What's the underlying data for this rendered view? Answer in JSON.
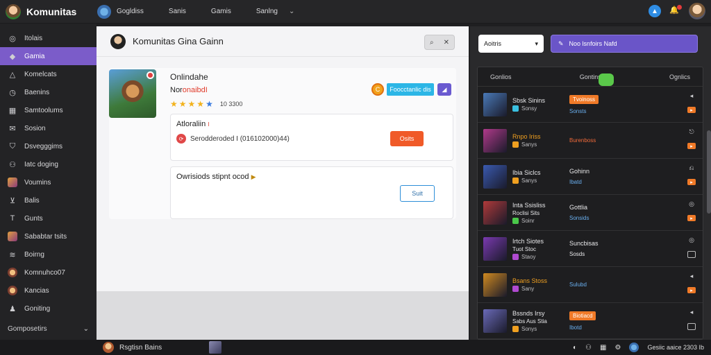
{
  "app": {
    "brand": "Komunitas"
  },
  "topnav": {
    "items": [
      "Gogldiss",
      "Sanis",
      "Gamis",
      "Sanlng"
    ]
  },
  "sidebar": {
    "items": [
      {
        "label": "Itolais",
        "icon": "compass-icon"
      },
      {
        "label": "Gamia",
        "icon": "flame-icon",
        "active": true
      },
      {
        "label": "Komelcats",
        "icon": "triangle-icon"
      },
      {
        "label": "Baenins",
        "icon": "clock-icon"
      },
      {
        "label": "Samtoolums",
        "icon": "grid-icon"
      },
      {
        "label": "Sosion",
        "icon": "mail-icon"
      },
      {
        "label": "Dsvegggims",
        "icon": "shield-icon"
      },
      {
        "label": "Iatc doging",
        "icon": "users-icon"
      },
      {
        "label": "Voumins",
        "icon": "game-avatar-icon"
      },
      {
        "label": "Balis",
        "icon": "chevron-box-icon"
      },
      {
        "label": "Gunts",
        "icon": "text-icon"
      },
      {
        "label": "Sababtar tsits",
        "icon": "card-icon"
      },
      {
        "label": "Boirng",
        "icon": "wave-icon"
      },
      {
        "label": "Komnuhco07",
        "icon": "orb-icon"
      },
      {
        "label": "Kancias",
        "icon": "avatar-icon"
      },
      {
        "label": "Goniting",
        "icon": "person-icon"
      }
    ],
    "footer": "Gomposetirs"
  },
  "main": {
    "header_title": "Komunitas Gina Gainn",
    "card": {
      "title": "Onlindahe",
      "status_prefix": "Nor",
      "status_red": "onaibd",
      "status_mark": "I",
      "rating_text": "10 3300",
      "stars": {
        "filled": 4,
        "blue": 1,
        "total": 5
      },
      "coin_symbol": "C",
      "cta_label": "Foocctanlic dis",
      "share_symbol": "◢",
      "sub1": {
        "title": "Atloraliin",
        "title_red": "I",
        "row_text": "Serodderoded I (016102000)44)",
        "button": "Osits"
      },
      "sub2": {
        "title": "Owrisiods stipnt ocod",
        "button": "Suit"
      }
    }
  },
  "right": {
    "select_label": "Aoitris",
    "action_label": "Noo lsnfoirs Nafd",
    "headers": [
      "Gonlios",
      "Gontins",
      "Ognlics"
    ],
    "rows": [
      {
        "name": "Sbsk Sinins",
        "sub": "Sonsy",
        "mid1": "Tvoinoss",
        "mid1_type": "tag",
        "mid2": "Sonsts",
        "mid2_color": "blue",
        "thumb": "#4a7ab8"
      },
      {
        "name": "Rnpo Iriss",
        "name_color": "orange",
        "sub": "Sanys",
        "mid1": "Burenboss",
        "mid1_type": "red",
        "mid2": "",
        "mid2_color": "",
        "thumb": "#b03a8a"
      },
      {
        "name": "Ibia Siclcs",
        "sub": "Sanys",
        "mid1": "Gohinn",
        "mid1_type": "white",
        "mid2": "Ibatd",
        "mid2_color": "blue",
        "thumb": "#3a5ab0"
      },
      {
        "name": "Inta Ssisliss",
        "name2": "Roclisi Sits",
        "sub": "Soinr",
        "mid1": "Gottlia",
        "mid1_type": "white",
        "mid2": "Sonsids",
        "mid2_color": "blue",
        "thumb": "#b03a3a"
      },
      {
        "name": "Irtch Siotes",
        "name2": "Tuot Stoc",
        "sub": "Staoy",
        "mid1": "Suncbisas",
        "mid1_type": "white",
        "mid2": "Sosds",
        "mid2_color": "white",
        "thumb": "#7a3ab0"
      },
      {
        "name": "Bsans Stoss",
        "name_color": "orange",
        "sub": "Sany",
        "mid1": "Sulubd",
        "mid1_type": "blue",
        "mid2": "",
        "mid2_color": "",
        "thumb": "#d08a20"
      },
      {
        "name": "Bssnds Irsy",
        "name2": "Sabs Aus Stia",
        "sub": "Sonys",
        "mid1": "Biotiacd",
        "mid1_type": "tag",
        "mid2": "Ibotd",
        "mid2_color": "blue",
        "thumb": "#6a6ab8"
      }
    ]
  },
  "bottombar": {
    "left_label": "Rsgtisn Bains",
    "right_label": "Gesiic aaice 2303 Ib"
  }
}
